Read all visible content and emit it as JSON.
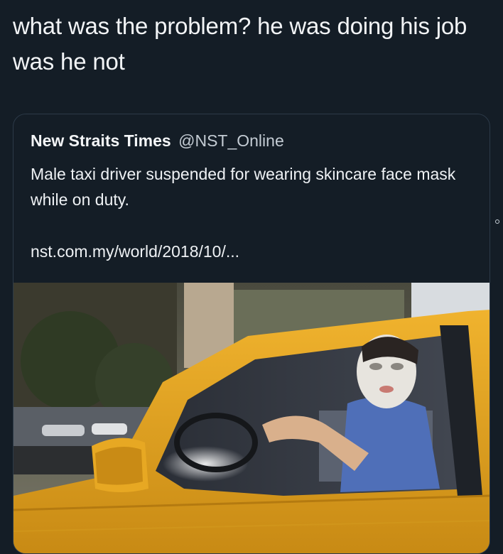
{
  "tweet": {
    "text": "what was the problem? he was doing his job was he not"
  },
  "quote": {
    "name": "New Straits Times",
    "handle": "@NST_Online",
    "text": "Male taxi driver suspended for wearing skincare face mask while on duty.",
    "link": "nst.com.my/world/2018/10/..."
  },
  "colors": {
    "background": "#141d26",
    "card_border": "#2c3a48",
    "taxi_yellow": "#e6a623"
  }
}
